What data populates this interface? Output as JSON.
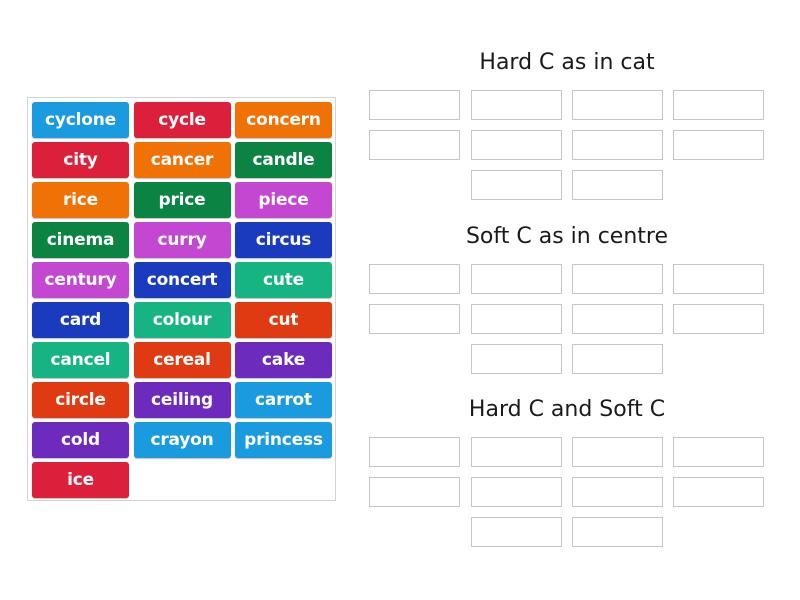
{
  "word_bank": [
    {
      "word": "cyclone",
      "color": "#1a9be0"
    },
    {
      "word": "cycle",
      "color": "#dc1f3b"
    },
    {
      "word": "concern",
      "color": "#f07106"
    },
    {
      "word": "city",
      "color": "#dc1f3b"
    },
    {
      "word": "cancer",
      "color": "#f07106"
    },
    {
      "word": "candle",
      "color": "#0b8443"
    },
    {
      "word": "rice",
      "color": "#f07106"
    },
    {
      "word": "price",
      "color": "#0b8443"
    },
    {
      "word": "piece",
      "color": "#c447d2"
    },
    {
      "word": "cinema",
      "color": "#0b8443"
    },
    {
      "word": "curry",
      "color": "#c447d2"
    },
    {
      "word": "circus",
      "color": "#1b3bbf"
    },
    {
      "word": "century",
      "color": "#c447d2"
    },
    {
      "word": "concert",
      "color": "#1b3bbf"
    },
    {
      "word": "cute",
      "color": "#16b482"
    },
    {
      "word": "card",
      "color": "#1b3bbf"
    },
    {
      "word": "colour",
      "color": "#16b482"
    },
    {
      "word": "cut",
      "color": "#e03a12"
    },
    {
      "word": "cancel",
      "color": "#16b482"
    },
    {
      "word": "cereal",
      "color": "#e03a12"
    },
    {
      "word": "cake",
      "color": "#6d2bbd"
    },
    {
      "word": "circle",
      "color": "#e03a12"
    },
    {
      "word": "ceiling",
      "color": "#6d2bbd"
    },
    {
      "word": "carrot",
      "color": "#1a9be0"
    },
    {
      "word": "cold",
      "color": "#6d2bbd"
    },
    {
      "word": "crayon",
      "color": "#1a9be0"
    },
    {
      "word": "princess",
      "color": "#1a9be0"
    },
    {
      "word": "ice",
      "color": "#dc1f3b"
    }
  ],
  "groups": [
    {
      "title": "Hard C as in cat",
      "slots": 10
    },
    {
      "title": "Soft C as in centre",
      "slots": 10
    },
    {
      "title": "Hard C and Soft C",
      "slots": 10
    }
  ]
}
